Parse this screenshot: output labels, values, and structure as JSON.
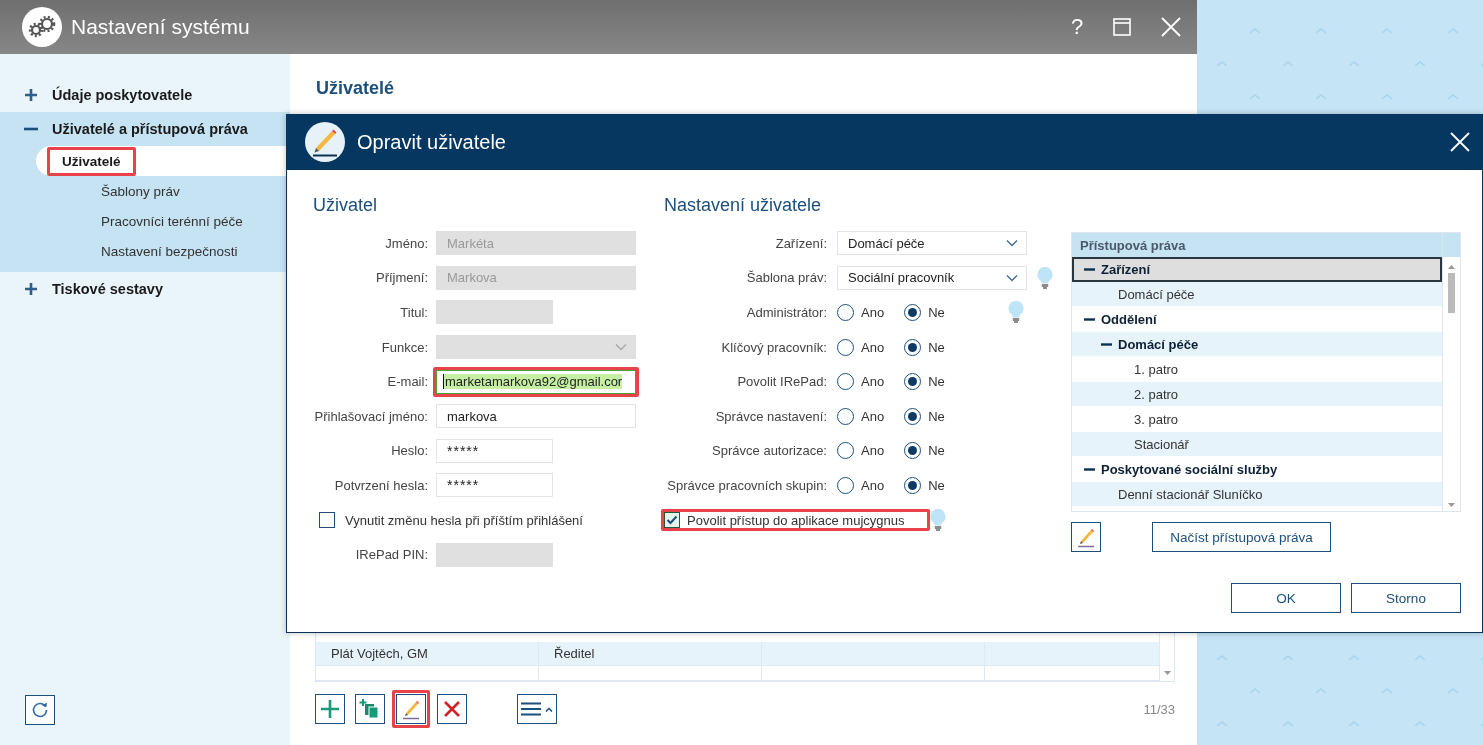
{
  "window": {
    "title": "Nastavení systému",
    "help": "?"
  },
  "sidebar": {
    "items": [
      {
        "label": "Údaje poskytovatele",
        "expanded": false
      },
      {
        "label": "Uživatelé a přístupová práva",
        "expanded": true,
        "children": [
          {
            "label": "Uživatelé",
            "selected": true,
            "highlighted": true
          },
          {
            "label": "Šablony práv",
            "selected": false,
            "highlighted": false
          },
          {
            "label": "Pracovníci terénní péče",
            "selected": false,
            "highlighted": false
          },
          {
            "label": "Nastavení bezpečnosti",
            "selected": false,
            "highlighted": false
          }
        ]
      },
      {
        "label": "Tiskové sestavy",
        "expanded": false
      }
    ]
  },
  "content": {
    "title": "Uživatelé",
    "table": {
      "rows": [
        {
          "cells": [
            "Plát Vojtěch, GM",
            "Ředitel"
          ]
        }
      ]
    },
    "toolbar": {
      "buttons": [
        {
          "kind": "add",
          "highlighted": false
        },
        {
          "kind": "add-copy",
          "highlighted": false
        },
        {
          "kind": "edit",
          "highlighted": true
        },
        {
          "kind": "delete",
          "highlighted": false
        },
        {
          "kind": "menu",
          "highlighted": false
        }
      ],
      "counter": "11/33"
    }
  },
  "dialog": {
    "title": "Opravit uživatele",
    "user": {
      "heading": "Uživatel",
      "fields": [
        {
          "kind": "text",
          "label": "Jméno:",
          "value": "Markéta",
          "disabled": true,
          "focused": false,
          "highlighted": false
        },
        {
          "kind": "text",
          "label": "Příjmení:",
          "value": "Markova",
          "disabled": true,
          "focused": false,
          "highlighted": false
        },
        {
          "kind": "narrow-text",
          "label": "Titul:",
          "disabled": true,
          "focused": false,
          "highlighted": false
        },
        {
          "kind": "select",
          "label": "Funkce:",
          "disabled": true,
          "focused": false,
          "highlighted": false
        },
        {
          "kind": "text",
          "label": "E-mail:",
          "value": "marketamarkova92@gmail.cor",
          "disabled": false,
          "focused": true,
          "highlighted": true
        },
        {
          "kind": "text",
          "label": "Přihlašovací jméno:",
          "value": "markova",
          "disabled": false,
          "focused": false,
          "highlighted": false
        },
        {
          "kind": "password",
          "label": "Heslo:",
          "value": "*****",
          "disabled": false,
          "focused": false,
          "highlighted": false
        },
        {
          "kind": "password",
          "label": "Potvrzení hesla:",
          "value": "*****",
          "disabled": false,
          "focused": false,
          "highlighted": false
        },
        {
          "kind": "checkbox",
          "label": "Vynutit změnu hesla při příštím přihlášení",
          "checked": false,
          "highlighted": false
        },
        {
          "kind": "narrow-text",
          "label": "IRePad PIN:",
          "disabled": true,
          "focused": false,
          "highlighted": false
        }
      ]
    },
    "settings": {
      "heading": "Nastavení uživatele",
      "fields": [
        {
          "kind": "select",
          "label": "Zařízení:",
          "value": "Domácí péče",
          "hint": false,
          "highlighted": false
        },
        {
          "kind": "select",
          "label": "Šablona práv:",
          "value": "Sociální pracovník",
          "hint": true,
          "highlighted": false
        },
        {
          "kind": "radio",
          "label": "Administrátor:",
          "options": [
            {
              "label": "Ano",
              "selected": false
            },
            {
              "label": "Ne",
              "selected": true
            }
          ],
          "hint": true,
          "highlighted": false
        },
        {
          "kind": "radio",
          "label": "Klíčový pracovník:",
          "options": [
            {
              "label": "Ano",
              "selected": false
            },
            {
              "label": "Ne",
              "selected": true
            }
          ],
          "hint": false,
          "highlighted": false
        },
        {
          "kind": "radio",
          "label": "Povolit IRePad:",
          "options": [
            {
              "label": "Ano",
              "selected": false
            },
            {
              "label": "Ne",
              "selected": true
            }
          ],
          "hint": false,
          "highlighted": false
        },
        {
          "kind": "radio",
          "label": "Správce nastavení:",
          "options": [
            {
              "label": "Ano",
              "selected": false
            },
            {
              "label": "Ne",
              "selected": true
            }
          ],
          "hint": false,
          "highlighted": false
        },
        {
          "kind": "radio",
          "label": "Správce autorizace:",
          "options": [
            {
              "label": "Ano",
              "selected": false
            },
            {
              "label": "Ne",
              "selected": true
            }
          ],
          "hint": false,
          "highlighted": false
        },
        {
          "kind": "radio",
          "label": "Správce pracovních skupin:",
          "options": [
            {
              "label": "Ano",
              "selected": false
            },
            {
              "label": "Ne",
              "selected": true
            }
          ],
          "hint": false,
          "highlighted": false
        },
        {
          "kind": "checkbox",
          "label": "Povolit přístup do aplikace mujcygnus",
          "checked": true,
          "hint": true,
          "highlighted": true
        }
      ]
    },
    "rights": {
      "header": "Přístupová práva",
      "tree": [
        {
          "label": "Zařízení",
          "expanded": true,
          "selected": true,
          "children": [
            {
              "label": "Domácí péče",
              "selected": false
            }
          ]
        },
        {
          "label": "Oddělení",
          "expanded": true,
          "selected": false,
          "children": [
            {
              "label": "Domácí péče",
              "expanded": true,
              "selected": false,
              "children": [
                {
                  "label": "1. patro",
                  "selected": false
                },
                {
                  "label": "2. patro",
                  "selected": false
                },
                {
                  "label": "3. patro",
                  "selected": false
                },
                {
                  "label": "Stacionář",
                  "selected": false
                }
              ]
            }
          ]
        },
        {
          "label": "Poskytované sociální služby",
          "expanded": true,
          "selected": false,
          "children": [
            {
              "label": "Denní stacionář Sluníčko",
              "selected": false
            }
          ]
        }
      ],
      "load_button": "Načíst přístupová práva"
    },
    "buttons": [
      "OK",
      "Storno"
    ]
  }
}
